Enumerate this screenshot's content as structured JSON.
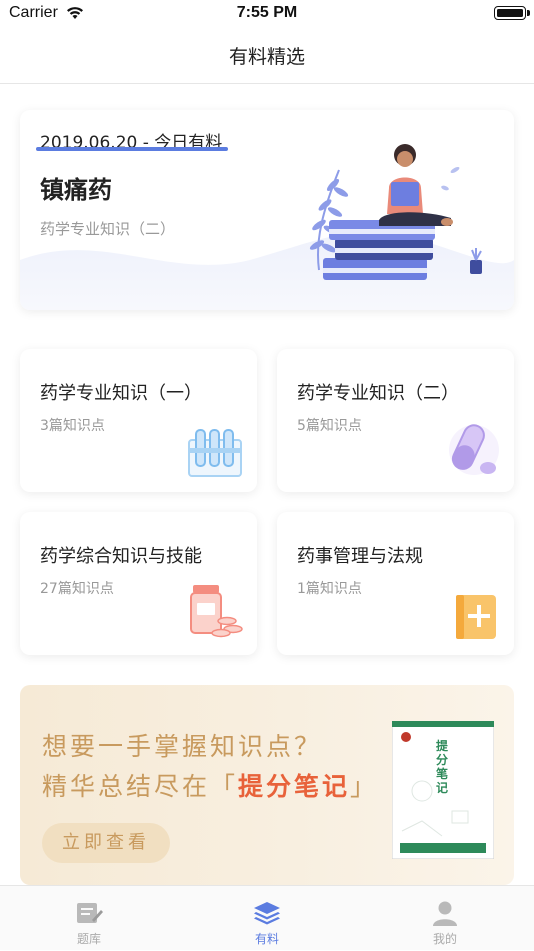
{
  "status_bar": {
    "carrier": "Carrier",
    "time": "7:55 PM"
  },
  "nav": {
    "title": "有料精选"
  },
  "feature": {
    "date": "2019.06.20 - 今日有料",
    "title": "镇痛药",
    "subtitle": "药学专业知识（二）",
    "accent": "#5b7ce0"
  },
  "categories": [
    {
      "title": "药学专业知识（一）",
      "count": "3篇知识点",
      "icon": "test-tubes-icon"
    },
    {
      "title": "药学专业知识（二）",
      "count": "5篇知识点",
      "icon": "capsule-pill-icon"
    },
    {
      "title": "药学综合知识与技能",
      "count": "27篇知识点",
      "icon": "medicine-bottle-icon"
    },
    {
      "title": "药事管理与法规",
      "count": "1篇知识点",
      "icon": "medical-book-icon"
    }
  ],
  "promo": {
    "line1": "想要一手掌握知识点？",
    "line2_prefix": "精华总结尽在「",
    "line2_highlight": "提分笔记",
    "line2_suffix": "」",
    "button": "立即查看",
    "book_title": "提分笔记"
  },
  "tabs": [
    {
      "label": "题库",
      "icon": "question-bank-icon",
      "active": false
    },
    {
      "label": "有料",
      "icon": "layers-icon",
      "active": true
    },
    {
      "label": "我的",
      "icon": "user-icon",
      "active": false
    }
  ]
}
